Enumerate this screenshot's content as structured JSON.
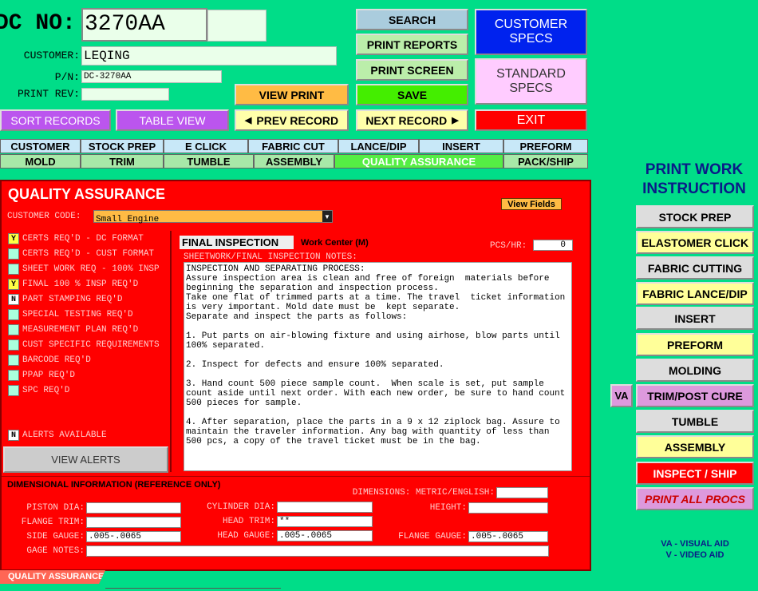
{
  "header": {
    "dc_label": "DC NO:",
    "dc_value": "3270AA",
    "customer_label": "CUSTOMER:",
    "customer_value": "LEQING",
    "pn_label": "P/N:",
    "pn_value": "DC-3270AA",
    "print_rev_label": "PRINT REV:",
    "print_rev_value": ""
  },
  "buttons": {
    "search": "SEARCH",
    "print_reports": "PRINT REPORTS",
    "print_screen": "PRINT SCREEN",
    "save": "SAVE",
    "view_print": "VIEW PRINT",
    "customer_specs": "CUSTOMER SPECS",
    "standard_specs": "STANDARD SPECS",
    "exit": "EXIT",
    "sort_records": "SORT RECORDS",
    "table_view": "TABLE VIEW",
    "prev_record": "PREV RECORD",
    "next_record": "NEXT RECORD"
  },
  "tabs_row1": [
    "CUSTOMER",
    "STOCK PREP",
    "E CLICK",
    "FABRIC CUT",
    "LANCE/DIP",
    "INSERT",
    "PREFORM"
  ],
  "tabs_row2": [
    "MOLD",
    "TRIM",
    "TUMBLE",
    "ASSEMBLY",
    "QUALITY ASSURANCE",
    "PACK/SHIP"
  ],
  "panel": {
    "title": "QUALITY ASSURANCE",
    "view_fields": "View Fields",
    "customer_code_label": "CUSTOMER CODE:",
    "customer_code_value": "Small Engine",
    "checklist": [
      {
        "flag": "Y",
        "label": "CERTS REQ'D - DC FORMAT"
      },
      {
        "flag": "",
        "label": "CERTS REQ'D - CUST FORMAT"
      },
      {
        "flag": "",
        "label": "SHEET WORK REQ - 100% INSP"
      },
      {
        "flag": "Y",
        "label": "FINAL 100 % INSP REQ'D"
      },
      {
        "flag": "N",
        "label": "PART STAMPING REQ'D"
      },
      {
        "flag": "",
        "label": "SPECIAL TESTING REQ'D"
      },
      {
        "flag": "",
        "label": "MEASUREMENT PLAN REQ'D"
      },
      {
        "flag": "",
        "label": "CUST SPECIFIC REQUIREMENTS"
      },
      {
        "flag": "",
        "label": "BARCODE REQ'D"
      },
      {
        "flag": "",
        "label": "PPAP REQ'D"
      },
      {
        "flag": "",
        "label": "SPC REQ'D"
      }
    ],
    "alerts_flag": "N",
    "alerts_label": "ALERTS AVAILABLE",
    "view_alerts": "VIEW ALERTS",
    "final_inspection_tab": "FINAL INSPECTION",
    "work_center": "Work Center (M)",
    "pcs_hr_label": "PCS/HR:",
    "pcs_hr_value": "0",
    "notes_label": "SHEETWORK/FINAL INSPECTION NOTES:",
    "notes_text": "INSPECTION AND SEPARATING PROCESS:\nAssure inspection area is clean and free of foreign  materials before beginning the separation and inspection process.\nTake one flat of trimmed parts at a time. The travel  ticket information is very important. Mold date must be  kept separate.\nSeparate and inspect the parts as follows:\n\n1. Put parts on air-blowing fixture and using airhose, blow parts until 100% separated.\n\n2. Inspect for defects and ensure 100% separated.\n\n3. Hand count 500 piece sample count.  When scale is set, put sample count aside until next order. With each new order, be sure to hand count 500 pieces for sample.\n\n4. After separation, place the parts in a 9 x 12 ziplock bag. Assure to maintain the traveler information. Any bag with quantity of less than 500 pcs, a copy of the travel ticket must be in the bag.",
    "dim_title": "DIMENSIONAL INFORMATION (REFERENCE ONLY)",
    "dimensions_label": "DIMENSIONS: METRIC/ENGLISH:",
    "piston_dia_label": "PISTON DIA:",
    "cylinder_dia_label": "CYLINDER DIA:",
    "height_label": "HEIGHT:",
    "flange_trim_label": "FLANGE TRIM:",
    "head_trim_label": "HEAD TRIM:",
    "head_trim_value": "**",
    "side_gauge_label": "SIDE GAUGE:",
    "side_gauge_value": ".005-.0065",
    "head_gauge_label": "HEAD GAUGE:",
    "head_gauge_value": ".005-.0065",
    "flange_gauge_label": "FLANGE GAUGE:",
    "flange_gauge_value": ".005-.0065",
    "gage_notes_label": "GAGE NOTES:"
  },
  "bottom_tab": "QUALITY ASSURANCE",
  "right": {
    "title": "PRINT WORK INSTRUCTION",
    "va_button": "VA",
    "items": [
      {
        "label": "STOCK PREP",
        "color": "#dddddd"
      },
      {
        "label": "ELASTOMER  CLICK",
        "color": "#ffff99"
      },
      {
        "label": "FABRIC CUTTING",
        "color": "#dddddd"
      },
      {
        "label": "FABRIC LANCE/DIP",
        "color": "#ffff99"
      },
      {
        "label": "INSERT",
        "color": "#dddddd"
      },
      {
        "label": "PREFORM",
        "color": "#ffff99"
      },
      {
        "label": "MOLDING",
        "color": "#dddddd"
      },
      {
        "label": "TRIM/POST CURE",
        "color": "#dd99dd"
      },
      {
        "label": "TUMBLE",
        "color": "#dddddd"
      },
      {
        "label": "ASSEMBLY",
        "color": "#ffff99"
      },
      {
        "label": "INSPECT / SHIP",
        "color": "#ff0000"
      },
      {
        "label": "PRINT ALL PROCS",
        "color": "#dd99dd"
      }
    ],
    "legend_va": "VA - VISUAL AID",
    "legend_v": "V - VIDEO AID"
  },
  "colors": {
    "background": "#00dd88",
    "panel": "#ff0000",
    "customer_specs": "#0022ee",
    "standard_specs": "#ffccff",
    "save": "#44ee00",
    "exit": "#ff0000",
    "sort": "#bb55ee",
    "view_print": "#ffbb44",
    "prev_next": "#ffffaa"
  }
}
